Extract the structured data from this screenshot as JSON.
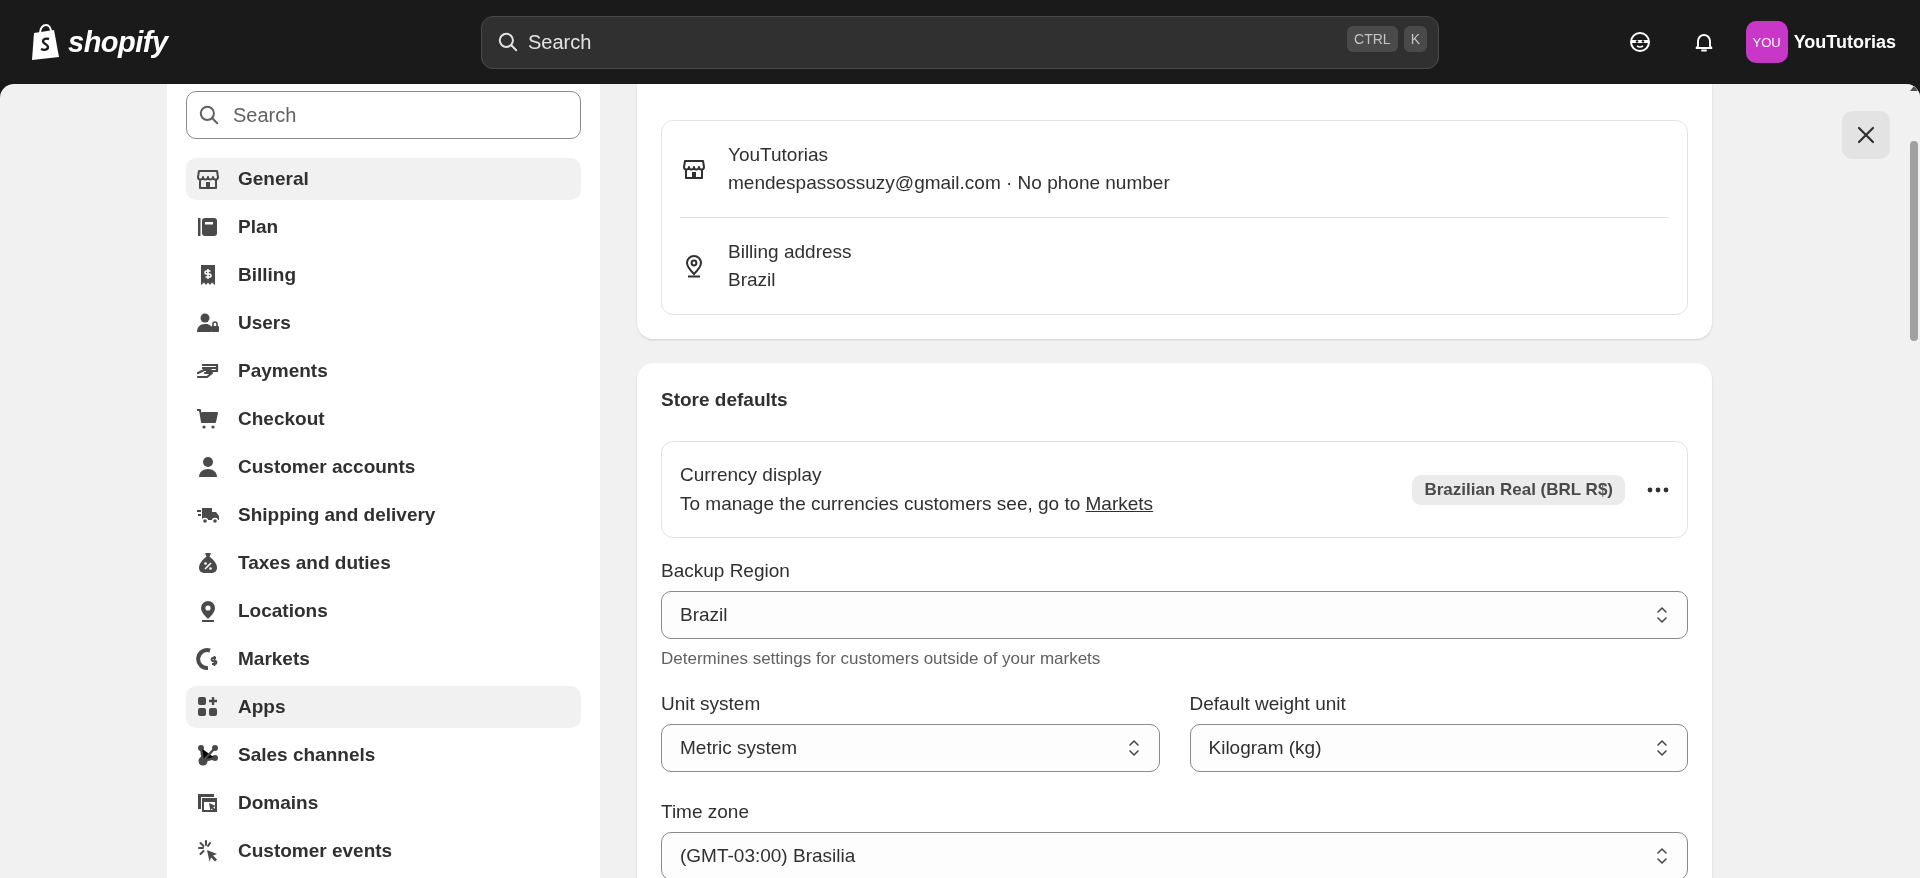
{
  "topbar": {
    "logo": "shopify",
    "search": {
      "placeholder": "Search"
    },
    "shortcut_keys": [
      "CTRL",
      "K"
    ],
    "avatar": "YOU",
    "store_name": "YouTutorias"
  },
  "sidebar": {
    "search": {
      "placeholder": "Search"
    },
    "items": [
      {
        "label": "General",
        "selected": true
      },
      {
        "label": "Plan",
        "selected": false
      },
      {
        "label": "Billing",
        "selected": false
      },
      {
        "label": "Users",
        "selected": false
      },
      {
        "label": "Payments",
        "selected": false
      },
      {
        "label": "Checkout",
        "selected": false
      },
      {
        "label": "Customer accounts",
        "selected": false
      },
      {
        "label": "Shipping and delivery",
        "selected": false
      },
      {
        "label": "Taxes and duties",
        "selected": false
      },
      {
        "label": "Locations",
        "selected": false
      },
      {
        "label": "Markets",
        "selected": false
      },
      {
        "label": "Apps",
        "selected": true
      },
      {
        "label": "Sales channels",
        "selected": false
      },
      {
        "label": "Domains",
        "selected": false
      },
      {
        "label": "Customer events",
        "selected": false
      }
    ]
  },
  "store_details": {
    "name": "YouTutorias",
    "contact": "mendespassossuzy@gmail.com · No phone number",
    "billing_label": "Billing address",
    "billing_value": "Brazil"
  },
  "store_defaults": {
    "title": "Store defaults",
    "currency": {
      "label": "Currency display",
      "note": "To manage the currencies customers see, go to ",
      "link": "Markets",
      "badge": "Brazilian Real (BRL R$)"
    },
    "fields": [
      {
        "kind": "full",
        "label": "Backup Region",
        "value": "Brazil",
        "help": "Determines settings for customers outside of your markets"
      },
      {
        "kind": "half",
        "label": "Unit system",
        "value": "Metric system"
      },
      {
        "kind": "half",
        "label": "Default weight unit",
        "value": "Kilogram (kg)"
      },
      {
        "kind": "full",
        "label": "Time zone",
        "value": "(GMT-03:00) Brasilia"
      }
    ]
  }
}
